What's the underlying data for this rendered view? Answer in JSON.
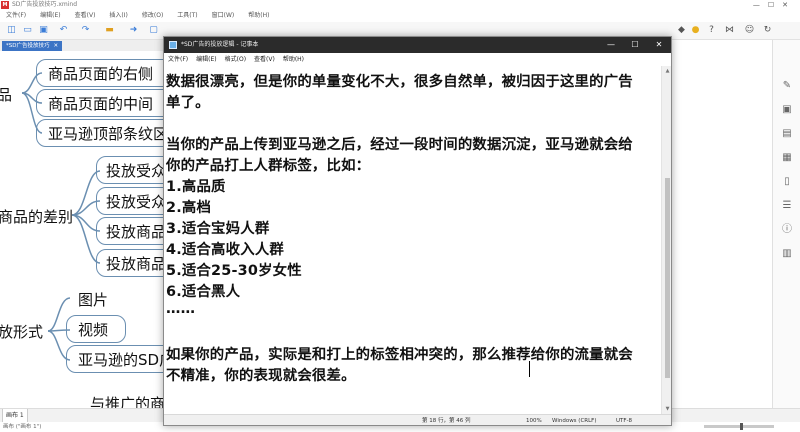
{
  "app": {
    "title": "SD广告投放技巧.xmind",
    "logo": "M",
    "window_buttons": [
      "—",
      "☐",
      "✕"
    ],
    "menu": [
      "文件(F)",
      "编辑(E)",
      "查看(V)",
      "插入(I)",
      "修改(O)",
      "工具(T)",
      "窗口(W)",
      "帮助(H)"
    ],
    "doc_tab": "*SD广告投放技巧",
    "doc_tab_close": "✕",
    "sheet_tab": "画布 1",
    "status": "画布 (\"画布 1\")",
    "toolbar_icons": [
      "new-icon",
      "open-icon",
      "save-icon",
      "undo-icon",
      "redo-icon",
      "folder-icon",
      "arrow-icon",
      "topic-icon",
      "subtopic-icon",
      "marker-icon",
      "pin-icon",
      "bulb-icon",
      "help-icon",
      "share-icon",
      "smiley-icon",
      "reload-icon"
    ],
    "right_panel_icons": [
      "brush-icon",
      "image-icon",
      "image2-icon",
      "grid-icon",
      "document-icon",
      "list-icon",
      "info-icon",
      "chart-icon"
    ]
  },
  "mindmap": {
    "nodes": [
      "品",
      "商品页面的右侧",
      "商品页面的中间",
      "亚马逊顶部条纹区",
      "投放受众",
      "投放受众",
      "投放商品",
      "投放商品",
      "商品的差别",
      "图片",
      "视频",
      "亚马逊的SD广",
      "放形式",
      "与推广的商品"
    ]
  },
  "notepad": {
    "title": "*SD广告的投放逻辑 - 记事本",
    "window_buttons": [
      "—",
      "☐",
      "✕"
    ],
    "menu": [
      "文件(F)",
      "编辑(E)",
      "格式(O)",
      "查看(V)",
      "帮助(H)"
    ],
    "lines": [
      "数据很漂亮，但是你的单量变化不大，很多自然单，被归因于这里的广告",
      "单了。",
      "当你的产品上传到亚马逊之后，经过一段时间的数据沉淀，亚马逊就会给",
      "你的产品打上人群标签，比如：",
      "1.高品质",
      "2.高档",
      "3.适合宝妈人群",
      "4.适合高收入人群",
      "5.适合25-30岁女性",
      "6.适合黑人",
      "……",
      "如果你的产品，实际是和打上的标签相冲突的，那么推荐给你的流量就会",
      "不精准，你的表现就会很差。"
    ],
    "status": {
      "position": "第 18 行，第 46 列",
      "zoom": "100%",
      "line_ending": "Windows (CRLF)",
      "encoding": "UTF-8"
    }
  }
}
